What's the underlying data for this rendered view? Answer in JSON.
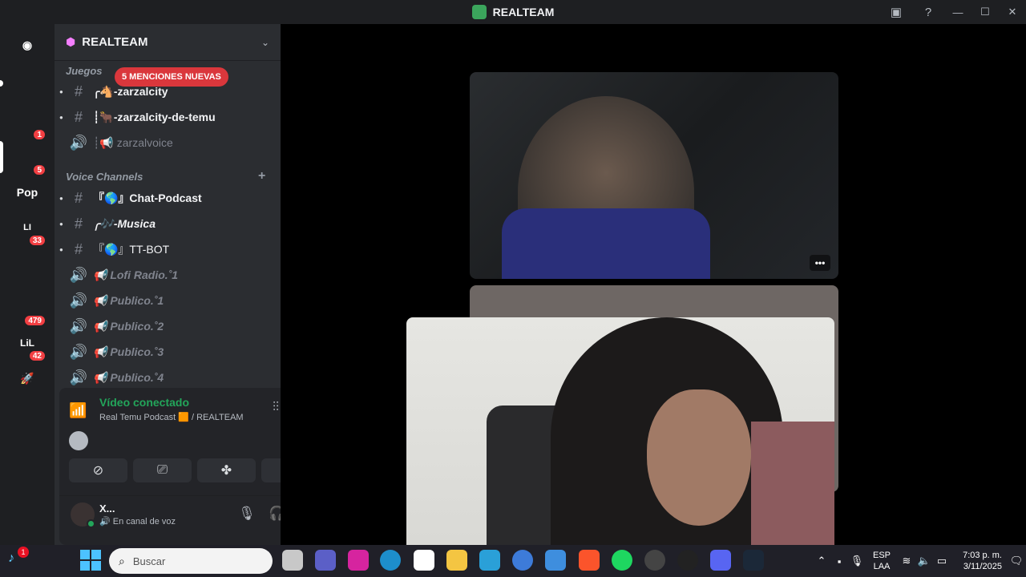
{
  "window": {
    "title": "REALTEAM",
    "icons": {
      "inbox": "inbox-icon",
      "help": "help-icon"
    },
    "controls": {
      "minimize": "—",
      "maximize": "☐",
      "close": "✕"
    }
  },
  "rail": {
    "servers": [
      {
        "name": "discord-home",
        "label": "",
        "color": "#5865f2",
        "badge": ""
      },
      {
        "name": "server-frog",
        "label": "",
        "color": "#4a7c3a",
        "badge": ""
      },
      {
        "name": "server-cartoon",
        "label": "",
        "color": "#c0504d",
        "badge": "1"
      },
      {
        "name": "server-realteam",
        "label": "",
        "color": "#3ba55c",
        "badge": "5"
      },
      {
        "name": "server-pop",
        "label": "Pop",
        "color": "#1e1f22",
        "badge": ""
      },
      {
        "name": "server-li",
        "label": "LI",
        "color": "#313338",
        "badge": "33"
      },
      {
        "name": "server-sticker",
        "label": "",
        "color": "#2f8fbf",
        "badge": ""
      },
      {
        "name": "server-yellow",
        "label": "",
        "color": "#f0c419",
        "badge": "479"
      },
      {
        "name": "server-lil",
        "label": "LiL",
        "color": "#e0462a",
        "badge": "42"
      },
      {
        "name": "server-rocket",
        "label": "🚀",
        "color": "#c6303a",
        "badge": ""
      }
    ]
  },
  "sidebar": {
    "server_name": "REALTEAM",
    "mentions_pill": "5 MENCIONES NUEVAS",
    "categories": [
      {
        "label": "Juegos"
      },
      {
        "label": "Voice Channels",
        "add": "+"
      }
    ],
    "channels": [
      {
        "type": "text",
        "name": "╭🐴-zarzalcity"
      },
      {
        "type": "text",
        "name": "┊🐂-zarzalcity-de-temu"
      },
      {
        "type": "voice",
        "name": "┊📢 zarzalvoice"
      },
      {
        "type": "text",
        "name": "『🌎』Chat-Podcast"
      },
      {
        "type": "text",
        "name": "╭🎶-Musica"
      },
      {
        "type": "text",
        "name": "『🌎』TT-BOT"
      },
      {
        "type": "voice",
        "name": "📢 Lofi Radio.˚1"
      },
      {
        "type": "voice",
        "name": "📢 Publico.˚1"
      },
      {
        "type": "voice",
        "name": "📢 Publico.˚2"
      },
      {
        "type": "voice",
        "name": "📢 Publico.˚3"
      },
      {
        "type": "voice",
        "name": "📢 Publico.˚4"
      }
    ]
  },
  "voice_panel": {
    "status": "Vídeo conectado",
    "channel": "Real Temu Podcast 🟧 / REALTEAM",
    "buttons": [
      "camera-off",
      "share-screen",
      "activities",
      "soundboard"
    ]
  },
  "user": {
    "name": "X...",
    "status": "🔊 En canal de voz"
  },
  "main": {
    "tile_menu": "•••"
  },
  "taskbar": {
    "left_badge": "1",
    "search_placeholder": "Buscar",
    "language": [
      "ESP",
      "LAA"
    ],
    "time": "7:03 p. m.",
    "date": "3/11/2025"
  }
}
